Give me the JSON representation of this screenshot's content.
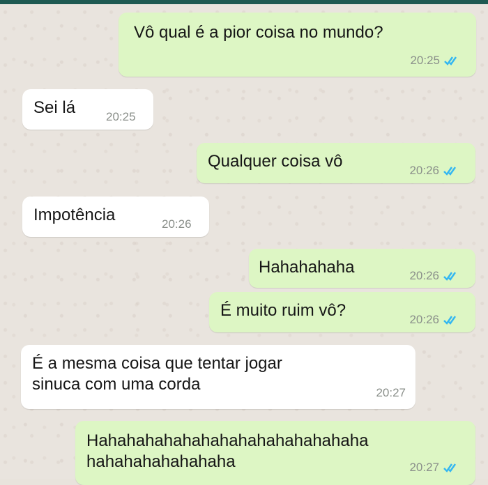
{
  "app": {
    "header_color": "#1e5a52",
    "bubble_out_color": "#ddf6c4",
    "bubble_in_color": "#ffffff",
    "tick_color": "#34b7f1"
  },
  "messages": [
    {
      "direction": "outgoing",
      "text": "Vô qual é a pior coisa no mundo?",
      "time": "20:25",
      "status_icon": "double-check-icon"
    },
    {
      "direction": "incoming",
      "text": "Sei lá",
      "time": "20:25"
    },
    {
      "direction": "outgoing",
      "text": "Qualquer coisa vô",
      "time": "20:26",
      "status_icon": "double-check-icon"
    },
    {
      "direction": "incoming",
      "text": "Impotência",
      "time": "20:26"
    },
    {
      "direction": "outgoing",
      "text": "Hahahahaha",
      "time": "20:26",
      "status_icon": "double-check-icon"
    },
    {
      "direction": "outgoing",
      "text": "É muito ruim vô?",
      "time": "20:26",
      "status_icon": "double-check-icon"
    },
    {
      "direction": "incoming",
      "text": "É a mesma coisa que tentar jogar\nsinuca com uma corda",
      "time": "20:27"
    },
    {
      "direction": "outgoing",
      "text": "Hahahahahahahahahahahahahahaha\nhahahahahahahaha",
      "time": "20:27",
      "status_icon": "double-check-icon"
    }
  ]
}
